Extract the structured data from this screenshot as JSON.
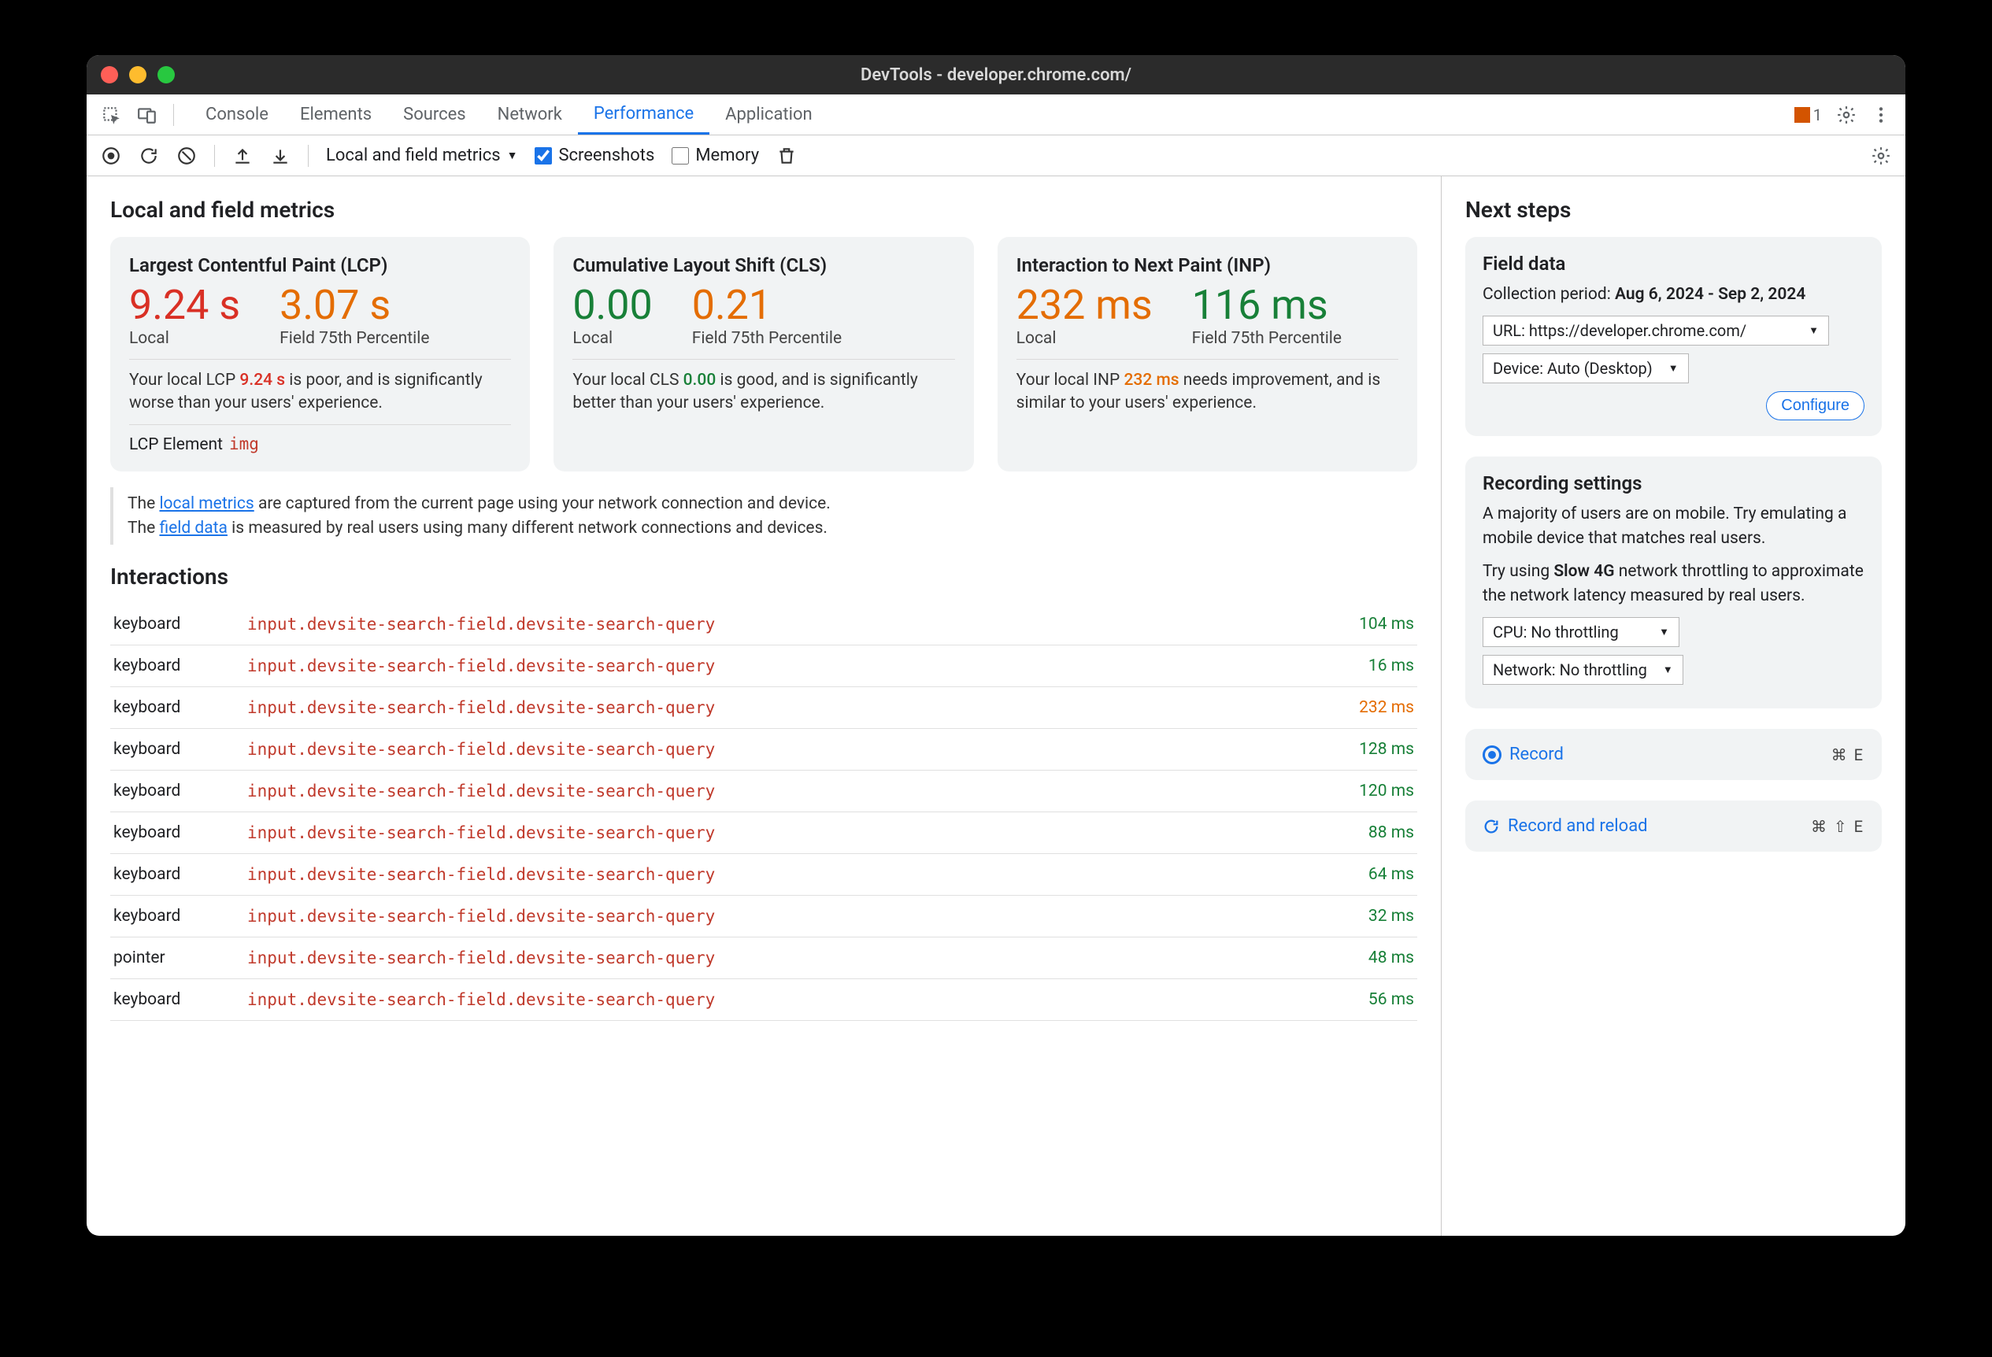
{
  "window": {
    "title": "DevTools - developer.chrome.com/"
  },
  "tabs": {
    "items": [
      "Console",
      "Elements",
      "Sources",
      "Network",
      "Performance",
      "Application"
    ],
    "active_index": 4,
    "issues_badge": "1"
  },
  "toolbar": {
    "preset_label": "Local and field metrics",
    "screenshots_label": "Screenshots",
    "screenshots_checked": true,
    "memory_label": "Memory",
    "memory_checked": false
  },
  "main": {
    "heading": "Local and field metrics",
    "cards": [
      {
        "title": "Largest Contentful Paint (LCP)",
        "local_value": "9.24 s",
        "local_class": "metric-red",
        "local_label": "Local",
        "field_value": "3.07 s",
        "field_class": "metric-orange",
        "field_label": "Field 75th Percentile",
        "desc_pre": "Your local LCP ",
        "desc_val": "9.24 s",
        "desc_val_class": "v-red",
        "desc_post": " is poor, and is significantly worse than your users' experience.",
        "lcp_element_label": "LCP Element",
        "lcp_element_tag": "img"
      },
      {
        "title": "Cumulative Layout Shift (CLS)",
        "local_value": "0.00",
        "local_class": "metric-green",
        "local_label": "Local",
        "field_value": "0.21",
        "field_class": "metric-orange",
        "field_label": "Field 75th Percentile",
        "desc_pre": "Your local CLS ",
        "desc_val": "0.00",
        "desc_val_class": "v-green",
        "desc_post": " is good, and is significantly better than your users' experience."
      },
      {
        "title": "Interaction to Next Paint (INP)",
        "local_value": "232 ms",
        "local_class": "metric-orange",
        "local_label": "Local",
        "field_value": "116 ms",
        "field_class": "metric-green",
        "field_label": "Field 75th Percentile",
        "desc_pre": "Your local INP ",
        "desc_val": "232 ms",
        "desc_val_class": "v-orange",
        "desc_post": " needs improvement, and is similar to your users' experience."
      }
    ],
    "info": {
      "line1_pre": "The ",
      "line1_link": "local metrics",
      "line1_post": " are captured from the current page using your network connection and device.",
      "line2_pre": "The ",
      "line2_link": "field data",
      "line2_post": " is measured by real users using many different network connections and devices."
    },
    "interactions_heading": "Interactions",
    "interactions": [
      {
        "type": "keyboard",
        "selector": "input.devsite-search-field.devsite-search-query",
        "ms": "104 ms",
        "ms_class": "ms-green"
      },
      {
        "type": "keyboard",
        "selector": "input.devsite-search-field.devsite-search-query",
        "ms": "16 ms",
        "ms_class": "ms-green"
      },
      {
        "type": "keyboard",
        "selector": "input.devsite-search-field.devsite-search-query",
        "ms": "232 ms",
        "ms_class": "ms-orange"
      },
      {
        "type": "keyboard",
        "selector": "input.devsite-search-field.devsite-search-query",
        "ms": "128 ms",
        "ms_class": "ms-green"
      },
      {
        "type": "keyboard",
        "selector": "input.devsite-search-field.devsite-search-query",
        "ms": "120 ms",
        "ms_class": "ms-green"
      },
      {
        "type": "keyboard",
        "selector": "input.devsite-search-field.devsite-search-query",
        "ms": "88 ms",
        "ms_class": "ms-green"
      },
      {
        "type": "keyboard",
        "selector": "input.devsite-search-field.devsite-search-query",
        "ms": "64 ms",
        "ms_class": "ms-green"
      },
      {
        "type": "keyboard",
        "selector": "input.devsite-search-field.devsite-search-query",
        "ms": "32 ms",
        "ms_class": "ms-green"
      },
      {
        "type": "pointer",
        "selector": "input.devsite-search-field.devsite-search-query",
        "ms": "48 ms",
        "ms_class": "ms-green"
      },
      {
        "type": "keyboard",
        "selector": "input.devsite-search-field.devsite-search-query",
        "ms": "56 ms",
        "ms_class": "ms-green"
      }
    ]
  },
  "sidebar": {
    "heading": "Next steps",
    "field_data": {
      "title": "Field data",
      "period_label": "Collection period: ",
      "period_value": "Aug 6, 2024 - Sep 2, 2024",
      "url_label": "URL: https://developer.chrome.com/",
      "device_label": "Device: Auto (Desktop)",
      "configure_label": "Configure"
    },
    "recording": {
      "title": "Recording settings",
      "p1": "A majority of users are on mobile. Try emulating a mobile device that matches real users.",
      "p2_pre": "Try using ",
      "p2_bold": "Slow 4G",
      "p2_post": " network throttling to approximate the network latency measured by real users.",
      "cpu_label": "CPU: No throttling",
      "network_label": "Network: No throttling"
    },
    "record": {
      "label": "Record",
      "shortcut": "⌘ E"
    },
    "record_reload": {
      "label": "Record and reload",
      "shortcut": "⌘ ⇧ E"
    }
  }
}
